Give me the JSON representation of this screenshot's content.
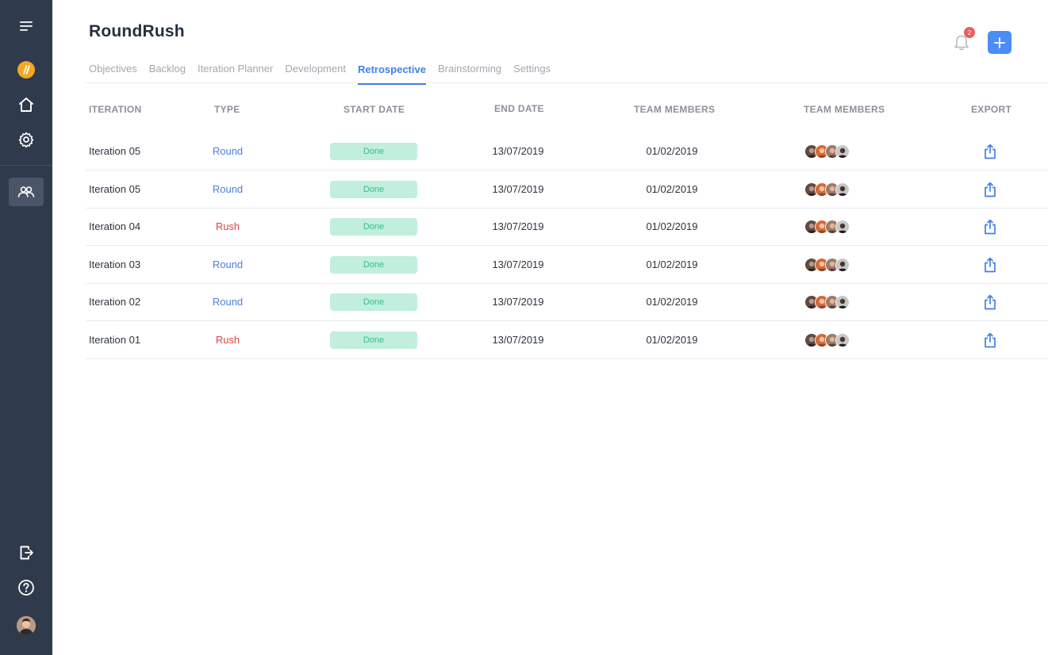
{
  "app": {
    "title": "RoundRush"
  },
  "notifications": {
    "count": "2"
  },
  "tabs": [
    {
      "label": "Objectives",
      "active": false
    },
    {
      "label": "Backlog",
      "active": false
    },
    {
      "label": "Iteration Planner",
      "active": false
    },
    {
      "label": "Development",
      "active": false
    },
    {
      "label": "Retrospective",
      "active": true
    },
    {
      "label": "Brainstorming",
      "active": false
    },
    {
      "label": "Settings",
      "active": false
    }
  ],
  "table": {
    "headers": {
      "iteration": "ITERATION",
      "type": "TYPE",
      "start_date": "START DATE",
      "end_date": "END DATE",
      "team_members_1": "TEAM MEMBERS",
      "team_members_2": "TEAM MEMBERS",
      "export": "EXPORT"
    },
    "rows": [
      {
        "iteration": "Iteration 05",
        "type": "Round",
        "status": "Done",
        "start": "13/07/2019",
        "end": "01/02/2019"
      },
      {
        "iteration": "Iteration 05",
        "type": "Round",
        "status": "Done",
        "start": "13/07/2019",
        "end": "01/02/2019"
      },
      {
        "iteration": "Iteration 04",
        "type": "Rush",
        "status": "Done",
        "start": "13/07/2019",
        "end": "01/02/2019"
      },
      {
        "iteration": "Iteration 03",
        "type": "Round",
        "status": "Done",
        "start": "13/07/2019",
        "end": "01/02/2019"
      },
      {
        "iteration": "Iteration 02",
        "type": "Round",
        "status": "Done",
        "start": "13/07/2019",
        "end": "01/02/2019"
      },
      {
        "iteration": "Iteration 01",
        "type": "Rush",
        "status": "Done",
        "start": "13/07/2019",
        "end": "01/02/2019"
      }
    ]
  },
  "colors": {
    "sidebar_bg": "#2f3a4c",
    "accent_blue": "#3f80ea",
    "round_blue": "#4a7fdc",
    "rush_red": "#e0444a",
    "done_bg": "#c1eedd",
    "done_text": "#37c08a",
    "badge_red": "#f05b5b",
    "logo_orange": "#f5a623"
  },
  "icons": {
    "sidebar": [
      "menu-icon",
      "logo-icon",
      "home-icon",
      "gear-icon",
      "team-icon",
      "logout-icon",
      "help-icon",
      "user-avatar"
    ],
    "header": [
      "bell-icon",
      "plus-icon"
    ],
    "row": [
      "avatar-stack",
      "export-icon"
    ]
  }
}
